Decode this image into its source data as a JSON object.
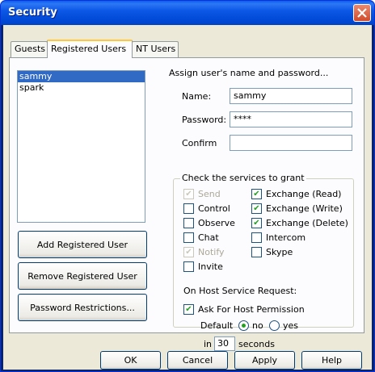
{
  "window": {
    "title": "Security",
    "close_icon": "close-icon"
  },
  "tabs": [
    {
      "label": "Guests"
    },
    {
      "label": "Registered Users"
    },
    {
      "label": "NT Users"
    }
  ],
  "users": [
    "sammy",
    "spark"
  ],
  "buttons": {
    "add": "Add Registered User",
    "remove": "Remove Registered User",
    "restrictions": "Password Restrictions..."
  },
  "form": {
    "assign_label": "Assign user's name and password...",
    "name_label": "Name:",
    "name_value": "sammy",
    "password_label": "Password:",
    "password_value": "****",
    "confirm_label": "Confirm",
    "confirm_value": ""
  },
  "services": {
    "group_title": "Check the services to grant",
    "items": [
      {
        "label": "Send",
        "checked": true,
        "disabled": true
      },
      {
        "label": "Control",
        "checked": false,
        "disabled": false
      },
      {
        "label": "Observe",
        "checked": false,
        "disabled": false
      },
      {
        "label": "Chat",
        "checked": false,
        "disabled": false
      },
      {
        "label": "Notify",
        "checked": true,
        "disabled": true
      },
      {
        "label": "Invite",
        "checked": false,
        "disabled": false
      },
      {
        "label": "Exchange (Read)",
        "checked": true,
        "disabled": false
      },
      {
        "label": "Exchange (Write)",
        "checked": true,
        "disabled": false
      },
      {
        "label": "Exchange (Delete)",
        "checked": true,
        "disabled": false
      },
      {
        "label": "Intercom",
        "checked": false,
        "disabled": false
      },
      {
        "label": "Skype",
        "checked": false,
        "disabled": false
      }
    ]
  },
  "host": {
    "title": "On Host Service Request:",
    "ask_label": "Ask For Host Permission",
    "ask_checked": true,
    "default_label": "Default",
    "no_label": "no",
    "yes_label": "yes",
    "selected": "no",
    "in_label": "in",
    "seconds_value": "30",
    "seconds_label": "seconds"
  },
  "footer": {
    "ok": "OK",
    "cancel": "Cancel",
    "apply": "Apply",
    "help": "Help"
  },
  "colors": {
    "title_bar": "#0054e3",
    "selection": "#316ac5",
    "check": "#21a121"
  }
}
